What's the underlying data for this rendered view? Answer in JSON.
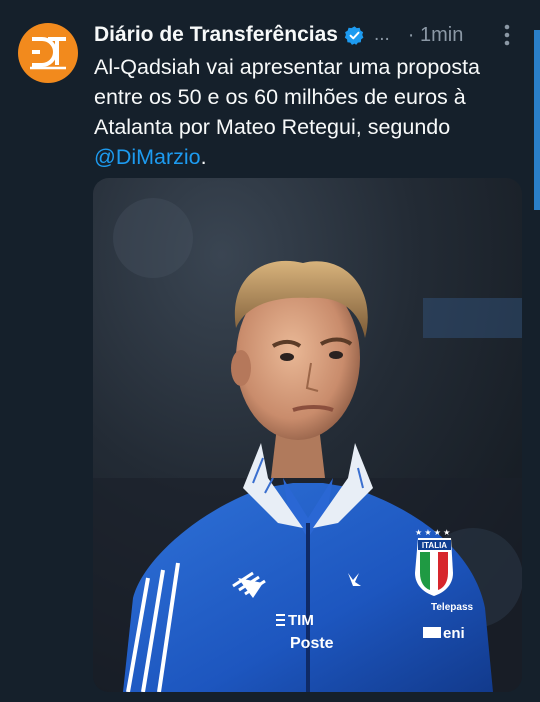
{
  "tweet": {
    "avatar_icon": "dt-logo-icon",
    "display_name": "Diário de Transferências",
    "verified_icon": "verified-badge-icon",
    "ellipsis": "...",
    "timestamp": "· 1min",
    "more_icon": "more-vertical-icon",
    "text_before": "Al-Qadsiah vai apresentar uma proposta entre os 50 e os 60 milhões de euros à Atalanta por Mateo Retegui, segundo ",
    "mention": "@DiMarzio",
    "text_after": ".",
    "media": {
      "kit_sponsors": [
        "TIM",
        "Poste",
        "Telepass",
        "eni"
      ],
      "crest_text": "ITALIA"
    }
  },
  "colors": {
    "background": "#15202b",
    "text": "#f7f9f9",
    "muted": "#8b98a5",
    "link": "#1d9bf0",
    "avatar": "#f28a1d",
    "jersey": "#1f5fc7"
  }
}
